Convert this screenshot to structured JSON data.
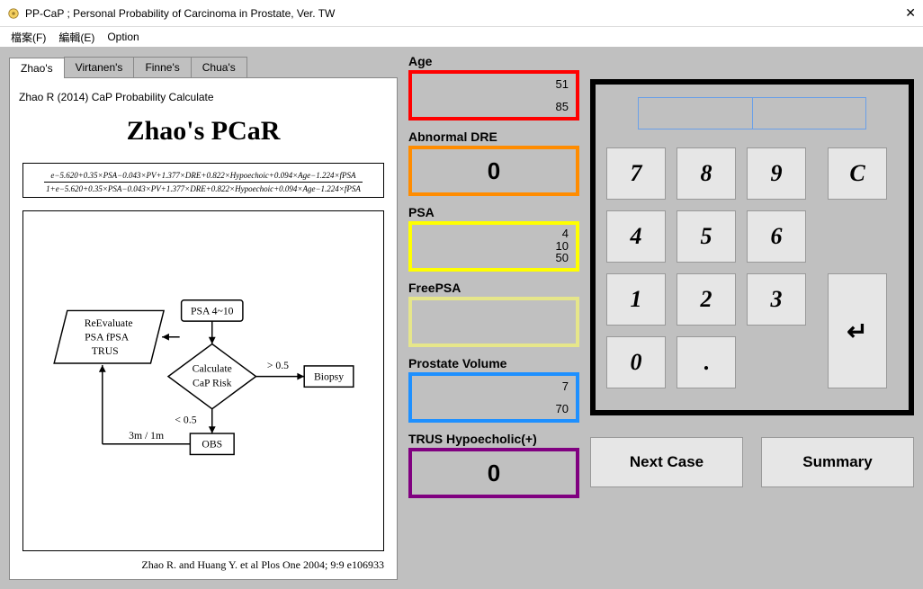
{
  "window": {
    "title": "PP-CaP ; Personal Probability of Carcinoma in Prostate, Ver. TW"
  },
  "menu": {
    "file": "檔案(F)",
    "edit": "編輯(E)",
    "option": "Option"
  },
  "tabs": [
    {
      "label": "Zhao's",
      "active": true
    },
    {
      "label": "Virtanen's",
      "active": false
    },
    {
      "label": "Finne's",
      "active": false
    },
    {
      "label": "Chua's",
      "active": false
    }
  ],
  "doc": {
    "caption": "Zhao R (2014) CaP Probability Calculate",
    "title": "Zhao's PCaR",
    "formula_num": "e−5.620+0.35×PSA−0.043×PV+1.377×DRE+0.822×Hypoechoic+0.094×Age−1.224×fPSA",
    "formula_den": "1+e−5.620+0.35×PSA−0.043×PV+1.377×DRE+0.822×Hypoechoic+0.094×Age−1.224×fPSA",
    "citation": "Zhao R.  and Huang Y. et al   Plos One 2004; 9:9 e106933"
  },
  "flow": {
    "psa_range": "PSA 4~10",
    "reeval_l1": "ReEvaluate",
    "reeval_l2": "PSA  fPSA",
    "reeval_l3": "TRUS",
    "calc_l1": "Calculate",
    "calc_l2": "CaP Risk",
    "gt": "> 0.5",
    "lt": "< 0.5",
    "biopsy": "Biopsy",
    "obs": "OBS",
    "loop": "3m / 1m"
  },
  "fields": {
    "age": {
      "label": "Age",
      "top": "51",
      "bottom": "85"
    },
    "dre": {
      "label": "Abnormal DRE",
      "center": "0"
    },
    "psa": {
      "label": "PSA",
      "top": "4",
      "mid": "10",
      "bottom": "50"
    },
    "fpsa": {
      "label": "FreePSA"
    },
    "pv": {
      "label": "Prostate Volume",
      "top": "7",
      "bottom": "70"
    },
    "trus": {
      "label": "TRUS Hypoecholic(+)",
      "center": "0"
    }
  },
  "keypad": {
    "k7": "7",
    "k8": "8",
    "k9": "9",
    "kc": "C",
    "k4": "4",
    "k5": "5",
    "k6": "6",
    "k1": "1",
    "k2": "2",
    "k3": "3",
    "enter": "↵",
    "k0": "0",
    "kdot": "."
  },
  "buttons": {
    "next": "Next Case",
    "summary": "Summary"
  }
}
